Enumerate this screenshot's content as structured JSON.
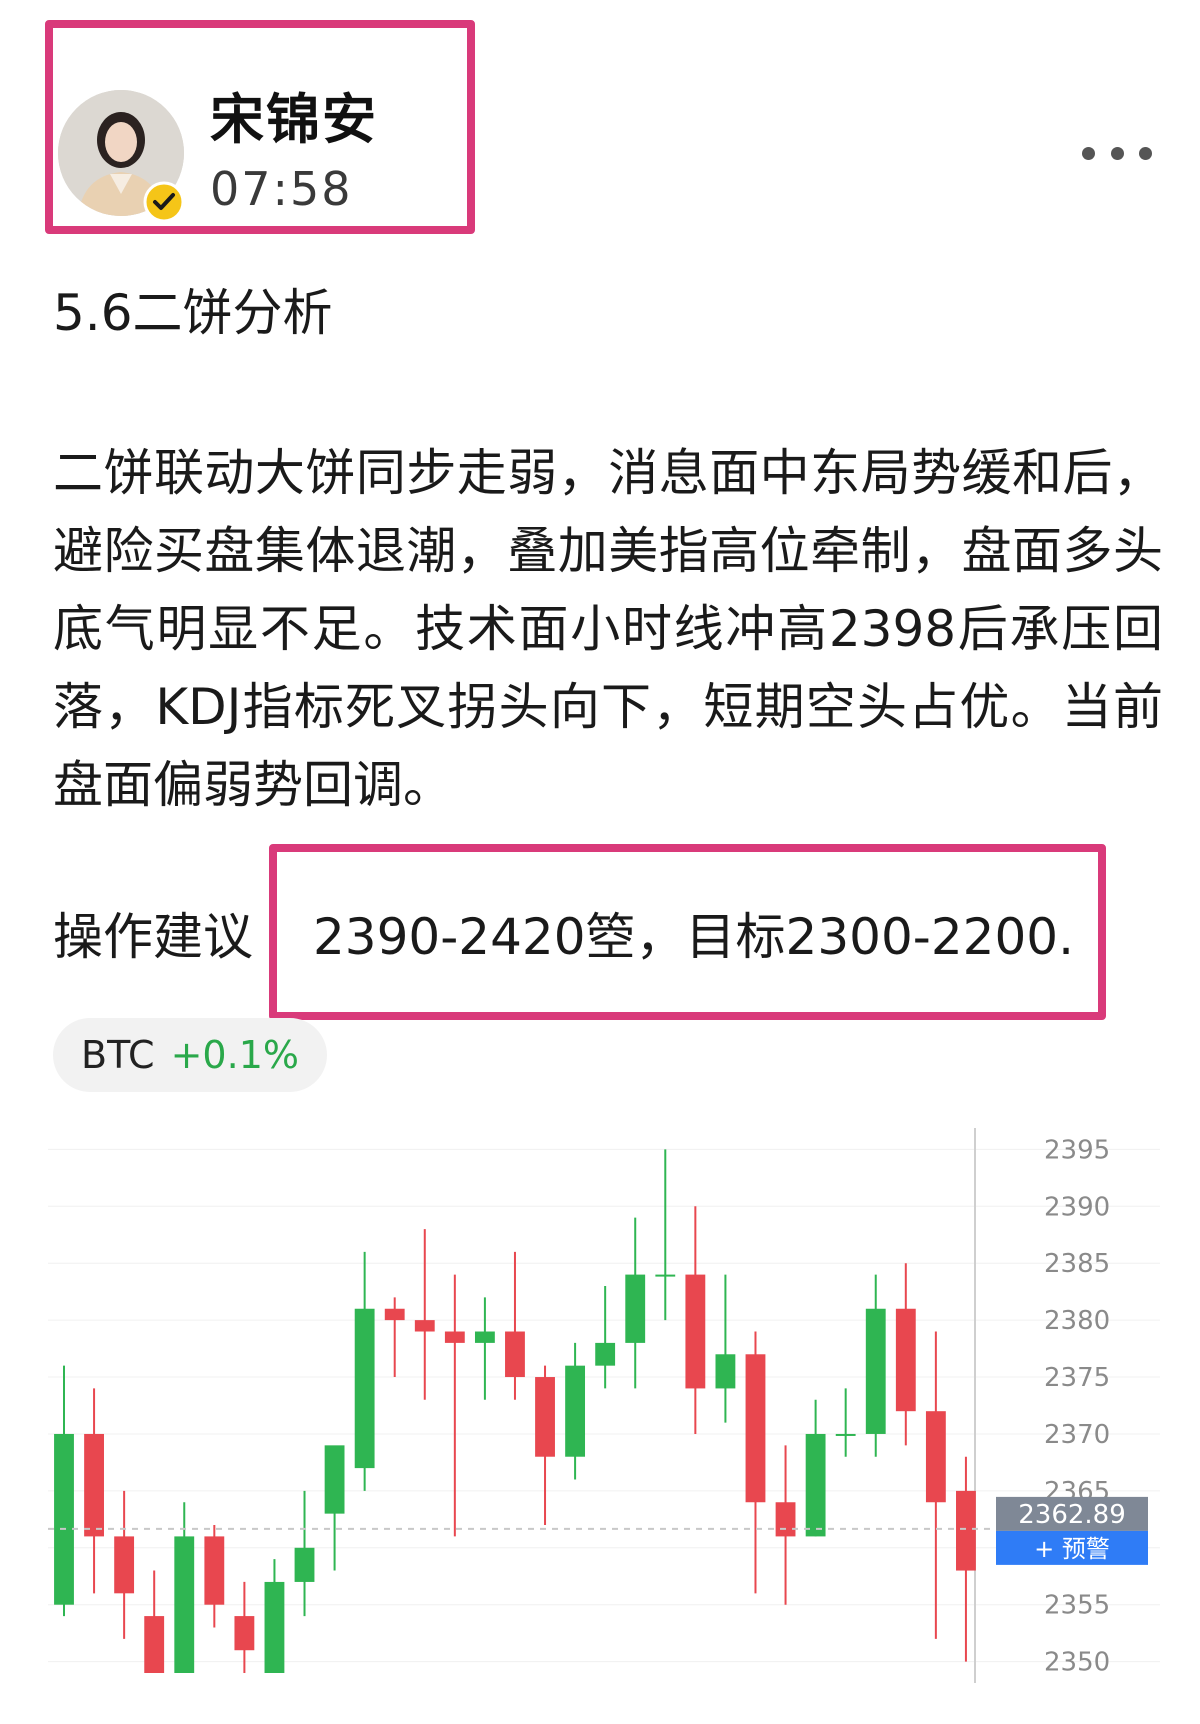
{
  "author": {
    "name": "宋锦安",
    "time": "07:58"
  },
  "post": {
    "title": "5.6二饼分析",
    "body": "二饼联动大饼同步走弱，消息面中东局势缓和后，避险买盘集体退潮，叠加美指高位牵制，盘面多头底气明显不足。技术面小时线冲高2398后承压回落，KDJ指标死叉拐头向下，短期空头占优。当前盘面偏弱势回调。",
    "advice_label": "操作建议",
    "advice_text": "2390-2420箜，目标2300-2200."
  },
  "ticker": {
    "symbol": "BTC",
    "change": "+0.1%",
    "change_color": "#2aa84a"
  },
  "chart_data": {
    "type": "candlestick",
    "y_ticks": [
      2395,
      2390,
      2385,
      2380,
      2375,
      2370,
      2365,
      2360,
      2355,
      2350
    ],
    "ylim": [
      2349,
      2396
    ],
    "last_price_label": "2362.89",
    "last_price": 2362.89,
    "alert_button_label": "+ 预警",
    "up_color": "#2fb552",
    "down_color": "#e8474f",
    "candles": [
      {
        "o": 2355,
        "h": 2376,
        "l": 2354,
        "c": 2370
      },
      {
        "o": 2370,
        "h": 2374,
        "l": 2356,
        "c": 2361
      },
      {
        "o": 2361,
        "h": 2365,
        "l": 2352,
        "c": 2356
      },
      {
        "o": 2354,
        "h": 2358,
        "l": 2349,
        "c": 2349
      },
      {
        "o": 2349,
        "h": 2364,
        "l": 2349,
        "c": 2361
      },
      {
        "o": 2361,
        "h": 2362,
        "l": 2353,
        "c": 2355
      },
      {
        "o": 2354,
        "h": 2357,
        "l": 2349,
        "c": 2351
      },
      {
        "o": 2349,
        "h": 2359,
        "l": 2349,
        "c": 2357
      },
      {
        "o": 2357,
        "h": 2365,
        "l": 2354,
        "c": 2360
      },
      {
        "o": 2363,
        "h": 2368,
        "l": 2358,
        "c": 2369
      },
      {
        "o": 2367,
        "h": 2386,
        "l": 2365,
        "c": 2381
      },
      {
        "o": 2381,
        "h": 2382,
        "l": 2375,
        "c": 2380
      },
      {
        "o": 2380,
        "h": 2388,
        "l": 2373,
        "c": 2379
      },
      {
        "o": 2379,
        "h": 2384,
        "l": 2361,
        "c": 2378
      },
      {
        "o": 2378,
        "h": 2382,
        "l": 2373,
        "c": 2379
      },
      {
        "o": 2379,
        "h": 2386,
        "l": 2373,
        "c": 2375
      },
      {
        "o": 2375,
        "h": 2376,
        "l": 2362,
        "c": 2368
      },
      {
        "o": 2368,
        "h": 2378,
        "l": 2366,
        "c": 2376
      },
      {
        "o": 2376,
        "h": 2383,
        "l": 2374,
        "c": 2378
      },
      {
        "o": 2378,
        "h": 2389,
        "l": 2374,
        "c": 2384
      },
      {
        "o": 2384,
        "h": 2395,
        "l": 2380,
        "c": 2384
      },
      {
        "o": 2384,
        "h": 2390,
        "l": 2370,
        "c": 2374
      },
      {
        "o": 2374,
        "h": 2384,
        "l": 2371,
        "c": 2377
      },
      {
        "o": 2377,
        "h": 2379,
        "l": 2356,
        "c": 2364
      },
      {
        "o": 2364,
        "h": 2369,
        "l": 2355,
        "c": 2361
      },
      {
        "o": 2361,
        "h": 2373,
        "l": 2361,
        "c": 2370
      },
      {
        "o": 2370,
        "h": 2374,
        "l": 2368,
        "c": 2370
      },
      {
        "o": 2370,
        "h": 2384,
        "l": 2368,
        "c": 2381
      },
      {
        "o": 2381,
        "h": 2385,
        "l": 2369,
        "c": 2372
      },
      {
        "o": 2372,
        "h": 2379,
        "l": 2352,
        "c": 2364
      },
      {
        "o": 2365,
        "h": 2368,
        "l": 2350,
        "c": 2358
      }
    ]
  }
}
